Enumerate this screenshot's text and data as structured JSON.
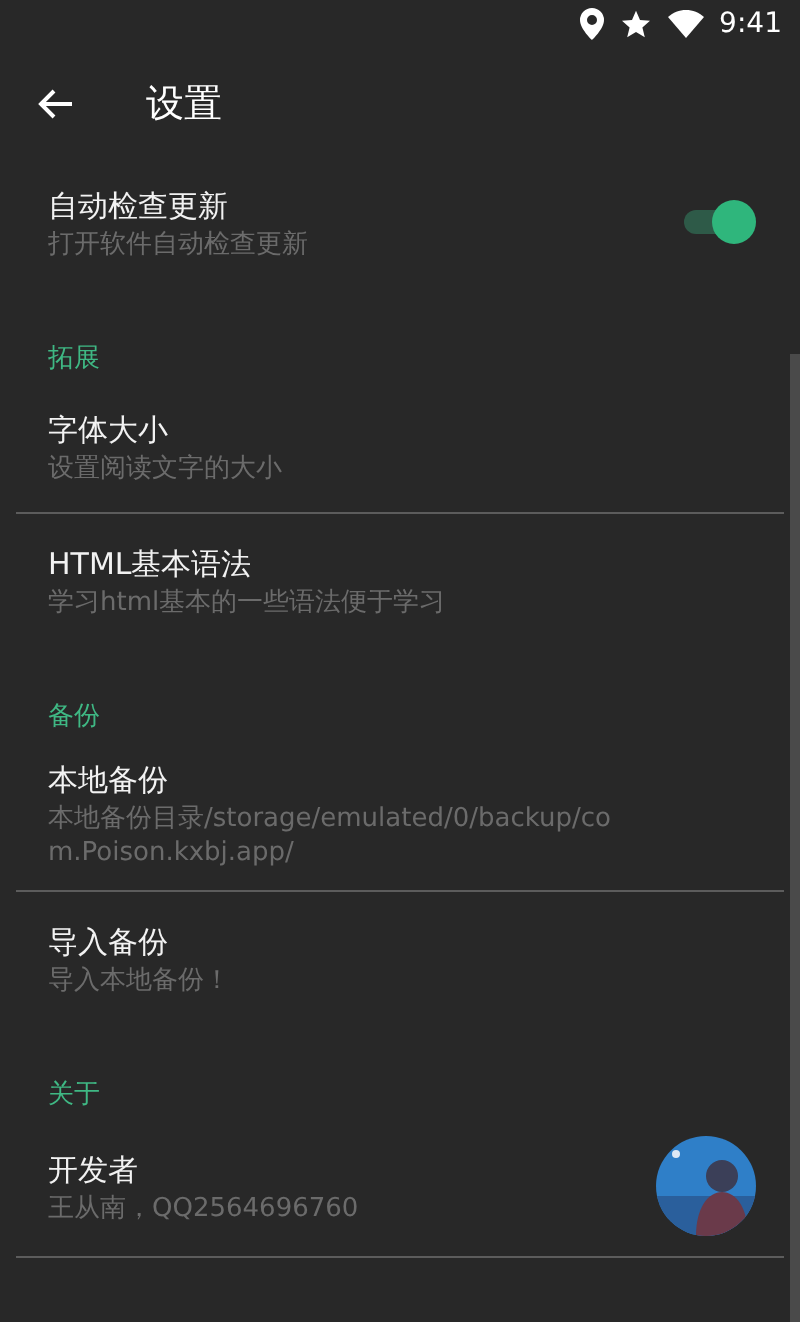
{
  "status_bar": {
    "time": "9:41"
  },
  "toolbar": {
    "title": "设置"
  },
  "sections": [
    {
      "items": [
        {
          "kind": "switch",
          "title": "自动检查更新",
          "subtitle": "打开软件自动检查更新",
          "on": true
        }
      ]
    },
    {
      "header": "拓展",
      "items": [
        {
          "kind": "plain",
          "title": "字体大小",
          "subtitle": "设置阅读文字的大小"
        },
        {
          "kind": "plain",
          "title": "HTML基本语法",
          "subtitle": "学习html基本的一些语法便于学习"
        }
      ]
    },
    {
      "header": "备份",
      "items": [
        {
          "kind": "plain",
          "title": "本地备份",
          "subtitle": "本地备份目录/storage/emulated/0/backup/com.Poison.kxbj.app/"
        },
        {
          "kind": "plain",
          "title": "导入备份",
          "subtitle": "导入本地备份！"
        }
      ]
    },
    {
      "header": "关于",
      "items": [
        {
          "kind": "avatar",
          "title": "开发者",
          "subtitle": "王从南，QQ2564696760"
        }
      ]
    }
  ]
}
